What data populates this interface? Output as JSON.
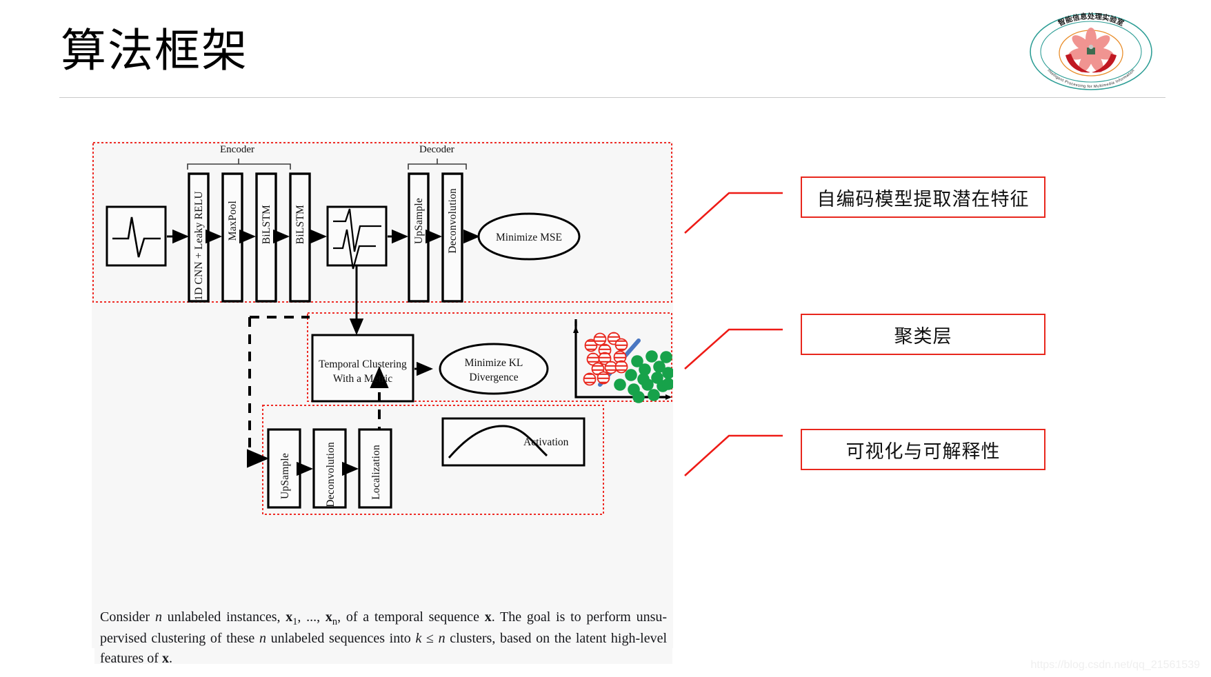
{
  "slide": {
    "title": "算法框架",
    "watermark": "https://blog.csdn.net/qq_21561539"
  },
  "logo": {
    "name": "lab-logo",
    "top_arc_text": "智能信息处理实验室",
    "bottom_arc_text": "Intelligent Processing for Multimedia Information",
    "ring_color": "#2e9e96",
    "flower_color": "#f08f8c",
    "hands_color": "#c01822"
  },
  "figure": {
    "groups": {
      "encoder": "Encoder",
      "decoder": "Decoder"
    },
    "encoder_blocks": [
      "1D CNN + Leaky RELU",
      "MaxPool",
      "BiLSTM",
      "BiLSTM"
    ],
    "decoder_blocks": [
      "UpSample",
      "Deconvolution"
    ],
    "bottom_blocks": [
      "UpSample",
      "Deconvolution",
      "Localization"
    ],
    "ellipses": {
      "mse": "Minimize MSE",
      "kl_line1": "Minimize KL",
      "kl_line2": "Divergence"
    },
    "cluster_box": {
      "line1": "Temporal Clustering",
      "line2": "With a Metric"
    },
    "activation_label": "Activation",
    "scatter": {
      "cluster_a_color": "#e8261c",
      "cluster_b_color": "#17a24a",
      "boundary_color": "#4a77c2",
      "cluster_a_count": 13,
      "cluster_b_count": 16
    },
    "dashed_region_color": "#ee2a24"
  },
  "callouts": [
    {
      "id": "autoencoder",
      "label": "自编码模型提取潜在特征"
    },
    {
      "id": "clustering",
      "label": "聚类层"
    },
    {
      "id": "visualization",
      "label": "可视化与可解释性"
    }
  ],
  "caption": {
    "part1": "Consider ",
    "n1": "n",
    "part2": " unlabeled instances, ",
    "x1": "x",
    "x1sub": "1",
    "part3": ", ..., ",
    "xn": "x",
    "xnsub": "n",
    "part4": ", of a temporal sequence ",
    "xbold": "x",
    "part5": ". The goal is to perform unsu-pervised clustering of these ",
    "n2": "n",
    "part6": " unlabeled sequences into ",
    "k": "k",
    "le": " ≤ ",
    "n3": "n",
    "part7": " clusters, based on the latent high-level features of ",
    "xbold2": "x",
    "part8": "."
  }
}
